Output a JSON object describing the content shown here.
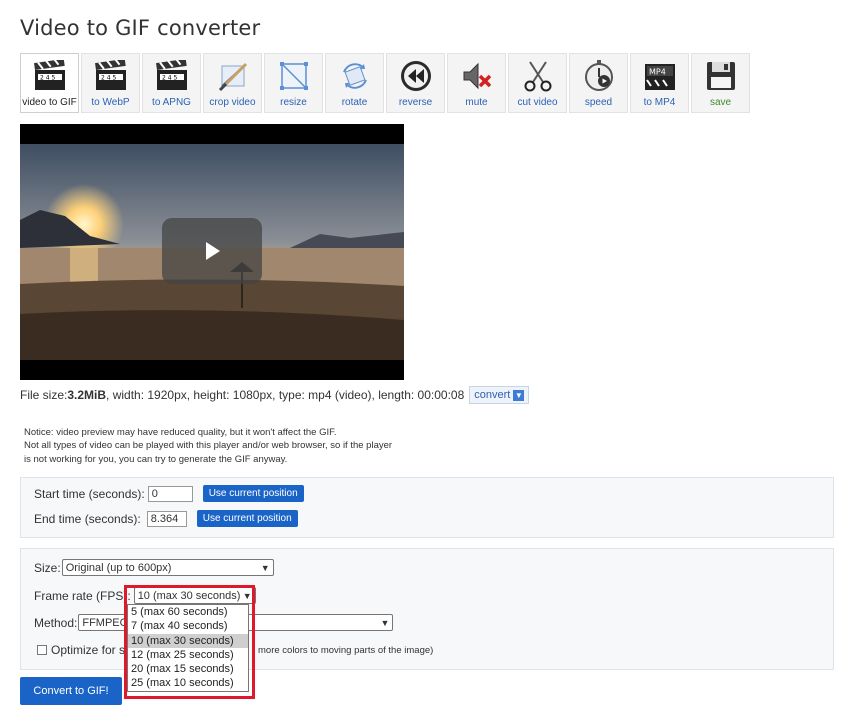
{
  "page_title": "Video to GIF converter",
  "toolbar": [
    {
      "label": "video to GIF",
      "icon": "clapperboard-icon",
      "active": true
    },
    {
      "label": "to WebP",
      "icon": "clapperboard-icon"
    },
    {
      "label": "to APNG",
      "icon": "clapperboard-icon"
    },
    {
      "label": "crop video",
      "icon": "crop-icon"
    },
    {
      "label": "resize",
      "icon": "resize-icon"
    },
    {
      "label": "rotate",
      "icon": "rotate-icon"
    },
    {
      "label": "reverse",
      "icon": "rewind-icon"
    },
    {
      "label": "mute",
      "icon": "mute-speaker-icon"
    },
    {
      "label": "cut video",
      "icon": "scissors-icon"
    },
    {
      "label": "speed",
      "icon": "stopwatch-icon"
    },
    {
      "label": "to MP4",
      "icon": "mp4-clapperboard-icon"
    },
    {
      "label": "save",
      "icon": "floppy-disk-icon"
    }
  ],
  "file_info": {
    "prefix": "File size: ",
    "size": "3.2MiB",
    "details": ", width: 1920px, height: 1080px, type: mp4 (video), length: 00:00:08",
    "convert_label": "convert"
  },
  "notice": {
    "line1": "Notice: video preview may have reduced quality, but it won't affect the GIF.",
    "line2": "Not all types of video can be played with this player and/or web browser, so if the player",
    "line3": "is not working for you, you can try to generate the GIF anyway."
  },
  "time": {
    "start_label": "Start time (seconds):",
    "start_value": "0",
    "end_label": "End time (seconds):",
    "end_value": "8.364",
    "use_current_label": "Use current position"
  },
  "options": {
    "size_label": "Size:",
    "size_value": "Original (up to 600px)",
    "fps_label": "Frame rate (FPS):",
    "fps_value": "10 (max 30 seconds)",
    "fps_options": [
      "5 (max 60 seconds)",
      "7 (max 40 seconds)",
      "10 (max 30 seconds)",
      "12 (max 25 seconds)",
      "20 (max 15 seconds)",
      "25 (max 10 seconds)"
    ],
    "fps_selected_index": 2,
    "method_label": "Method:",
    "method_value": "FFMPEG",
    "optimize_label_start": "Optimize for s",
    "optimize_hint": "more colors to moving parts of the image)"
  },
  "convert_button": "Convert to GIF!",
  "colors": {
    "accent": "#1a64c8",
    "highlight_frame": "#e0182b",
    "link": "#2a62b5"
  }
}
